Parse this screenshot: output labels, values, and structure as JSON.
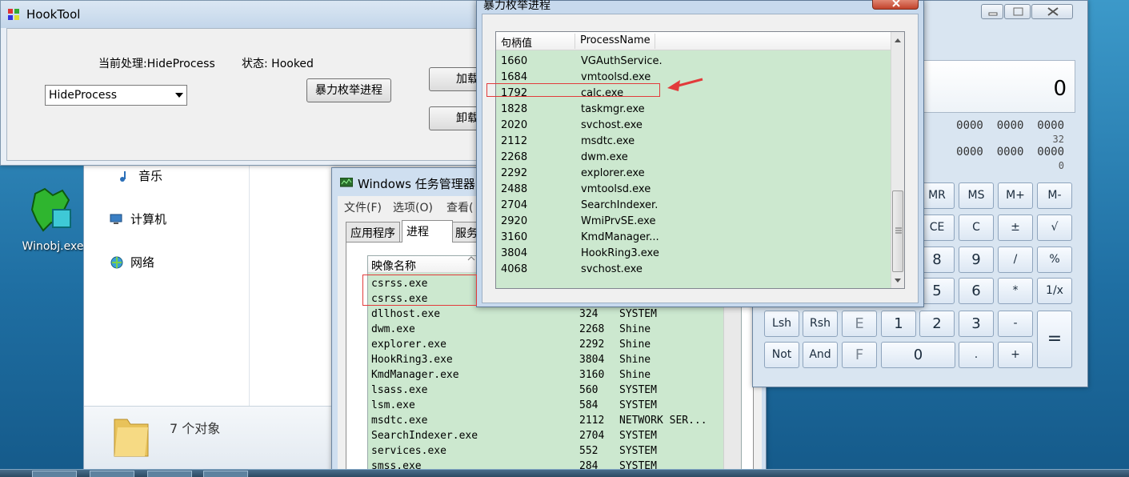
{
  "desktop": {
    "icon_label": "Winobj.exe"
  },
  "explorer": {
    "nav_items": [
      "音乐",
      "计算机",
      "网络"
    ],
    "status_count": "7 个对象"
  },
  "hooktool": {
    "title": "HookTool",
    "current_label": "当前处理:HideProcess",
    "status_label": "状态: Hooked",
    "combo_value": "HideProcess",
    "enum_button": "暴力枚举进程",
    "load_button": "加载",
    "unload_button": "卸载"
  },
  "taskmgr": {
    "title": "Windows 任务管理器",
    "menus": [
      "文件(F)",
      "选项(O)",
      "查看("
    ],
    "tabs": [
      "应用程序",
      "进程",
      "服务"
    ],
    "column_image": "映像名称",
    "rows": [
      {
        "name": "csrss.exe",
        "pid": "",
        "user": ""
      },
      {
        "name": "csrss.exe",
        "pid": "",
        "user": ""
      },
      {
        "name": "dllhost.exe",
        "pid": "324",
        "user": "SYSTEM"
      },
      {
        "name": "dwm.exe",
        "pid": "2268",
        "user": "Shine"
      },
      {
        "name": "explorer.exe",
        "pid": "2292",
        "user": "Shine"
      },
      {
        "name": "HookRing3.exe",
        "pid": "3804",
        "user": "Shine"
      },
      {
        "name": "KmdManager.exe",
        "pid": "3160",
        "user": "Shine"
      },
      {
        "name": "lsass.exe",
        "pid": "560",
        "user": "SYSTEM"
      },
      {
        "name": "lsm.exe",
        "pid": "584",
        "user": "SYSTEM"
      },
      {
        "name": "msdtc.exe",
        "pid": "2112",
        "user": "NETWORK SER..."
      },
      {
        "name": "SearchIndexer.exe",
        "pid": "2704",
        "user": "SYSTEM"
      },
      {
        "name": "services.exe",
        "pid": "552",
        "user": "SYSTEM"
      },
      {
        "name": "smss.exe",
        "pid": "284",
        "user": "SYSTEM"
      }
    ]
  },
  "calculator": {
    "display": "0",
    "bin_row1": "0000  0000  0000",
    "bin_num1": "32",
    "bin_row2": "0000  0000  0000",
    "bin_num2": "0",
    "keys": {
      "mr": "MR",
      "ms": "MS",
      "mplus": "M+",
      "mminus": "M-",
      "ce": "CE",
      "c": "C",
      "pm": "±",
      "sqrt": "√",
      "k8": "8",
      "k9": "9",
      "div": "/",
      "pct": "%",
      "k5": "5",
      "k6": "6",
      "mul": "*",
      "recip": "1/x",
      "lsh": "Lsh",
      "rsh": "Rsh",
      "e": "E",
      "k1": "1",
      "k2": "2",
      "k3": "3",
      "minus": "-",
      "eq": "=",
      "not": "Not",
      "and": "And",
      "f": "F",
      "k0": "0",
      "dot": ".",
      "plus": "+"
    }
  },
  "enum_dialog": {
    "title": "暴力枚举进程",
    "col_handle": "句柄值",
    "col_name": "ProcessName",
    "rows": [
      {
        "handle": "1660",
        "name": "VGAuthService."
      },
      {
        "handle": "1684",
        "name": "vmtoolsd.exe"
      },
      {
        "handle": "1792",
        "name": "calc.exe"
      },
      {
        "handle": "1828",
        "name": "taskmgr.exe"
      },
      {
        "handle": "2020",
        "name": "svchost.exe"
      },
      {
        "handle": "2112",
        "name": "msdtc.exe"
      },
      {
        "handle": "2268",
        "name": "dwm.exe"
      },
      {
        "handle": "2292",
        "name": "explorer.exe"
      },
      {
        "handle": "2488",
        "name": "vmtoolsd.exe"
      },
      {
        "handle": "2704",
        "name": "SearchIndexer."
      },
      {
        "handle": "2920",
        "name": "WmiPrvSE.exe"
      },
      {
        "handle": "3160",
        "name": "KmdManager..."
      },
      {
        "handle": "3804",
        "name": "HookRing3.exe"
      },
      {
        "handle": "4068",
        "name": "svchost.exe"
      }
    ]
  },
  "colors": {
    "list_green": "#cce8cf",
    "highlight_red": "#e23b3b"
  }
}
